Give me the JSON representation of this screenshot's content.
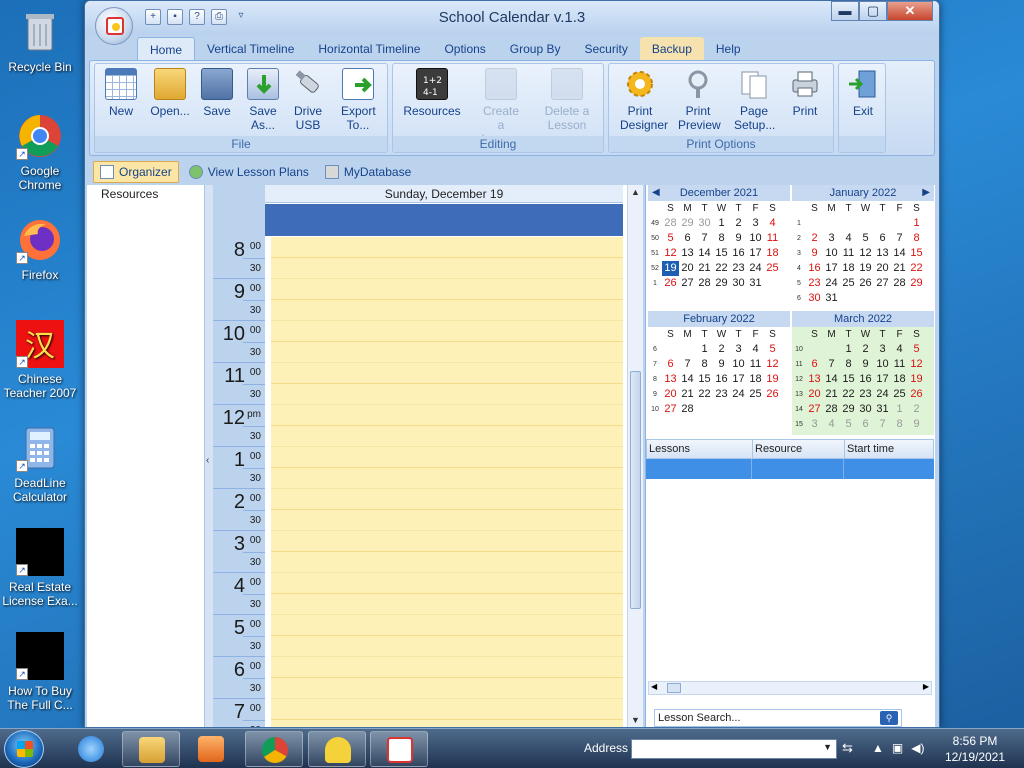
{
  "desktop": {
    "icons": [
      {
        "label": "Recycle Bin"
      },
      {
        "label": "Google Chrome"
      },
      {
        "label": "Firefox"
      },
      {
        "label": "Chinese Teacher 2007"
      },
      {
        "label": "DeadLine Calculator"
      },
      {
        "label": "Real Estate License Exa..."
      },
      {
        "label": "How To Buy The Full C..."
      }
    ]
  },
  "window": {
    "title": "School Calendar v.1.3",
    "controls": {
      "minimize": "▬",
      "maximize": "▢",
      "close": "✕"
    }
  },
  "ribbon": {
    "tabs": [
      "Home",
      "Vertical Timeline",
      "Horizontal Timeline",
      "Options",
      "Group By",
      "Security",
      "Backup",
      "Help"
    ],
    "active_tab": "Home",
    "groups": {
      "file": {
        "label": "File",
        "buttons": [
          "New",
          "Open...",
          "Save",
          "Save As...",
          "Drive USB",
          "Export To..."
        ]
      },
      "editing": {
        "label": "Editing",
        "buttons": [
          "Resources",
          "Create a Lesson",
          "Delete a Lesson"
        ]
      },
      "print": {
        "label": "Print Options",
        "buttons": [
          "Print Designer",
          "Print Preview",
          "Page Setup...",
          "Print"
        ]
      },
      "exit": {
        "label": "",
        "buttons": [
          "Exit"
        ]
      }
    }
  },
  "subbar": {
    "items": [
      "Organizer",
      "View Lesson Plans",
      "MyDatabase"
    ]
  },
  "resources": {
    "label": "Resources"
  },
  "schedule": {
    "day_header": "Sunday, December 19",
    "hours": [
      {
        "h": "8",
        "m": "00"
      },
      {
        "h": "9",
        "m": "00"
      },
      {
        "h": "10",
        "m": "00"
      },
      {
        "h": "11",
        "m": "00"
      },
      {
        "h": "12",
        "m": "pm"
      },
      {
        "h": "1",
        "m": "00"
      },
      {
        "h": "2",
        "m": "00"
      },
      {
        "h": "3",
        "m": "00"
      },
      {
        "h": "4",
        "m": "00"
      },
      {
        "h": "5",
        "m": "00"
      },
      {
        "h": "6",
        "m": "00"
      },
      {
        "h": "7",
        "m": "00"
      }
    ],
    "half_label": "30"
  },
  "mini_calendars": {
    "dow": [
      "S",
      "M",
      "T",
      "W",
      "T",
      "F",
      "S"
    ],
    "months": [
      {
        "name": "December 2021",
        "weeks": [
          [
            "49",
            "28",
            "29",
            "30",
            "1",
            "2",
            "3",
            "4"
          ],
          [
            "50",
            "5",
            "6",
            "7",
            "8",
            "9",
            "10",
            "11"
          ],
          [
            "51",
            "12",
            "13",
            "14",
            "15",
            "16",
            "17",
            "18"
          ],
          [
            "52",
            "19",
            "20",
            "21",
            "22",
            "23",
            "24",
            "25"
          ],
          [
            "1",
            "26",
            "27",
            "28",
            "29",
            "30",
            "31",
            ""
          ]
        ]
      },
      {
        "name": "January 2022",
        "weeks": [
          [
            "1",
            "",
            "",
            "",
            "",
            "",
            "",
            "1"
          ],
          [
            "2",
            "2",
            "3",
            "4",
            "5",
            "6",
            "7",
            "8"
          ],
          [
            "3",
            "9",
            "10",
            "11",
            "12",
            "13",
            "14",
            "15"
          ],
          [
            "4",
            "16",
            "17",
            "18",
            "19",
            "20",
            "21",
            "22"
          ],
          [
            "5",
            "23",
            "24",
            "25",
            "26",
            "27",
            "28",
            "29"
          ],
          [
            "6",
            "30",
            "31",
            "",
            "",
            "",
            "",
            ""
          ]
        ]
      },
      {
        "name": "February 2022",
        "weeks": [
          [
            "6",
            "",
            "",
            "1",
            "2",
            "3",
            "4",
            "5"
          ],
          [
            "7",
            "6",
            "7",
            "8",
            "9",
            "10",
            "11",
            "12"
          ],
          [
            "8",
            "13",
            "14",
            "15",
            "16",
            "17",
            "18",
            "19"
          ],
          [
            "9",
            "20",
            "21",
            "22",
            "23",
            "24",
            "25",
            "26"
          ],
          [
            "10",
            "27",
            "28",
            "",
            "",
            "",
            "",
            ""
          ]
        ]
      },
      {
        "name": "March 2022",
        "weeks": [
          [
            "10",
            "",
            "",
            "1",
            "2",
            "3",
            "4",
            "5"
          ],
          [
            "11",
            "6",
            "7",
            "8",
            "9",
            "10",
            "11",
            "12"
          ],
          [
            "12",
            "13",
            "14",
            "15",
            "16",
            "17",
            "18",
            "19"
          ],
          [
            "13",
            "20",
            "21",
            "22",
            "23",
            "24",
            "25",
            "26"
          ],
          [
            "14",
            "27",
            "28",
            "29",
            "30",
            "31",
            "1",
            "2"
          ],
          [
            "15",
            "3",
            "4",
            "5",
            "6",
            "7",
            "8",
            "9"
          ]
        ]
      }
    ],
    "today": "19"
  },
  "lessons_table": {
    "columns": [
      "Lessons",
      "Resource",
      "Start time"
    ]
  },
  "search": {
    "placeholder": "Lesson Search..."
  },
  "taskbar": {
    "address_label": "Address",
    "time": "8:56 PM",
    "date": "12/19/2021"
  }
}
